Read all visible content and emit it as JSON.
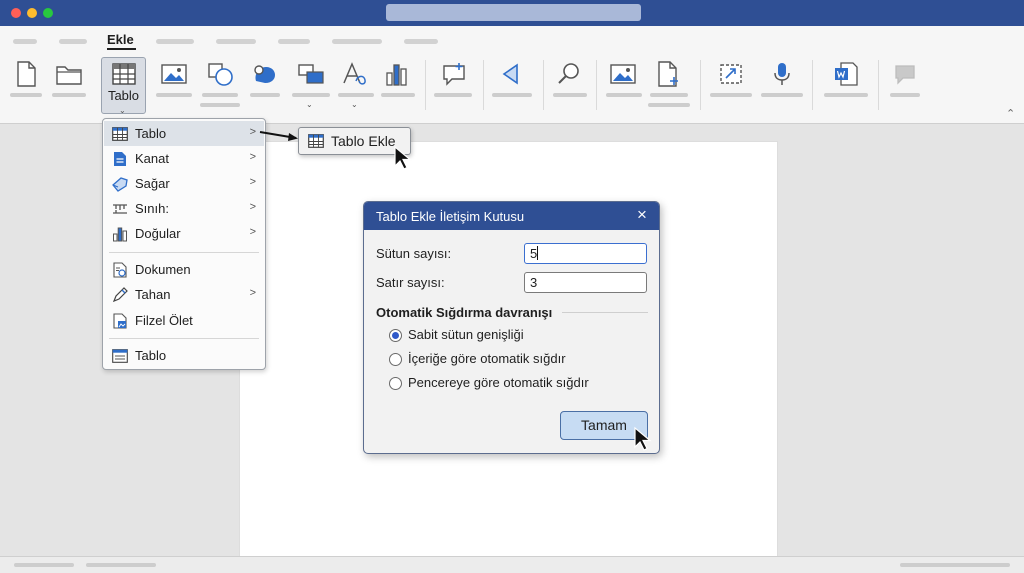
{
  "ribbon": {
    "active_tab": "Ekle",
    "table_button_label": "Tablo",
    "icons": [
      "new-document-icon",
      "folder-icon",
      "table-icon",
      "picture-icon",
      "shapes-icon",
      "icons-icon",
      "smartart-icon",
      "wordart-icon",
      "chart-icon",
      "comment-icon",
      "media-icon",
      "search-icon",
      "online-picture-icon",
      "add-file-icon",
      "screenshot-icon",
      "microphone-icon",
      "word-file-icon",
      "feedback-icon"
    ]
  },
  "menu": {
    "items": [
      {
        "label": "Tablo",
        "icon": "table-icon",
        "submenu": true
      },
      {
        "label": "Kanat",
        "icon": "document-icon",
        "submenu": true
      },
      {
        "label": "Sağar",
        "icon": "pen-tag-icon",
        "submenu": true
      },
      {
        "label": "Sınıh:",
        "icon": "ruler-icon",
        "submenu": true
      },
      {
        "label": "Doğular",
        "icon": "chart-icon",
        "submenu": true
      },
      {
        "label": "Dokumen",
        "icon": "document-link-icon",
        "submenu": false
      },
      {
        "label": "Tahan",
        "icon": "pencil-icon",
        "submenu": true
      },
      {
        "label": "Filzel Ölet",
        "icon": "file-image-icon",
        "submenu": false
      },
      {
        "label": "Tablo",
        "icon": "table-card-icon",
        "submenu": false
      }
    ]
  },
  "submenu": {
    "label": "Tablo Ekle"
  },
  "dialog": {
    "title": "Tablo Ekle İletişim Kutusu",
    "columns_label": "Sütun sayısı:",
    "columns_value": "5",
    "rows_label": "Satır sayısı:",
    "rows_value": "3",
    "autofit_heading": "Otomatik Sığdırma davranışı",
    "options": [
      {
        "label": "Sabit sütun genişliği",
        "selected": true
      },
      {
        "label": "İçeriğe göre otomatik sığdır",
        "selected": false
      },
      {
        "label": "Pencereye göre otomatik sığdır",
        "selected": false
      }
    ],
    "ok_label": "Tamam"
  },
  "colors": {
    "titlebar": "#2f4f94",
    "accent_icon": "#2f6ec9",
    "ok_button": "#c7dcf3"
  }
}
